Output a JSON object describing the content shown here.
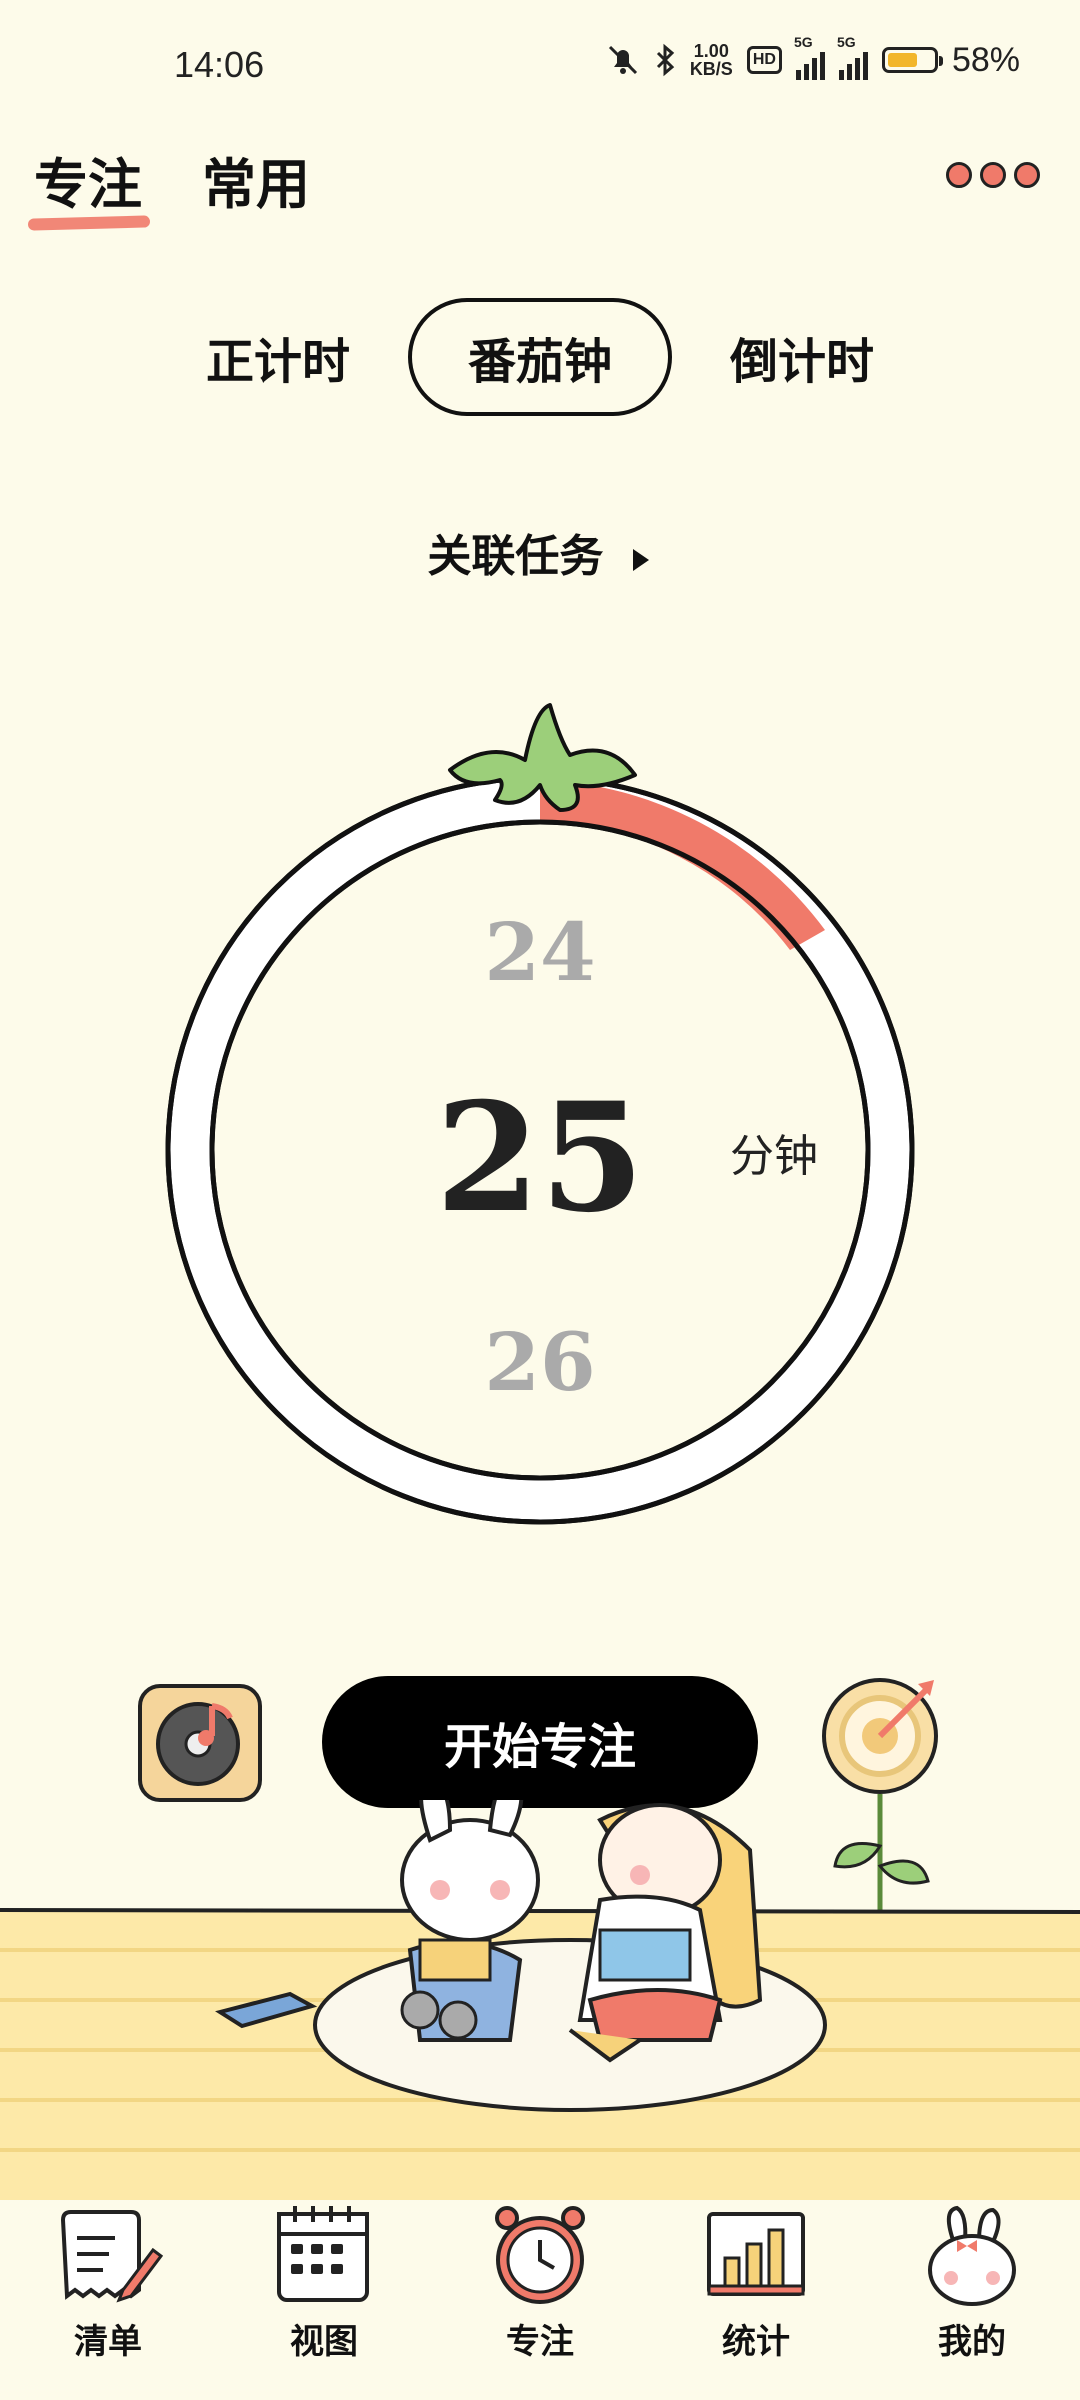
{
  "status": {
    "time": "14:06",
    "net_speed_top": "1.00",
    "net_speed_bottom": "KB/S",
    "hd": "HD",
    "sig1": "5G",
    "sig2": "5G",
    "battery": "58%",
    "battery_level": 0.58
  },
  "top_tabs": [
    {
      "label": "专注"
    },
    {
      "label": "常用"
    }
  ],
  "modes": [
    {
      "label": "正计时"
    },
    {
      "label": "番茄钟"
    },
    {
      "label": "倒计时"
    }
  ],
  "associate_task": "关联任务",
  "timer": {
    "prev": "24",
    "current": "25",
    "next": "26",
    "unit": "分钟"
  },
  "start_button": "开始专注",
  "nav": [
    {
      "label": "清单"
    },
    {
      "label": "视图"
    },
    {
      "label": "专注"
    },
    {
      "label": "统计"
    },
    {
      "label": "我的"
    }
  ],
  "colors": {
    "accent": "#f07a6a",
    "background": "#fdfbea",
    "leaf": "#9ccf7a"
  }
}
